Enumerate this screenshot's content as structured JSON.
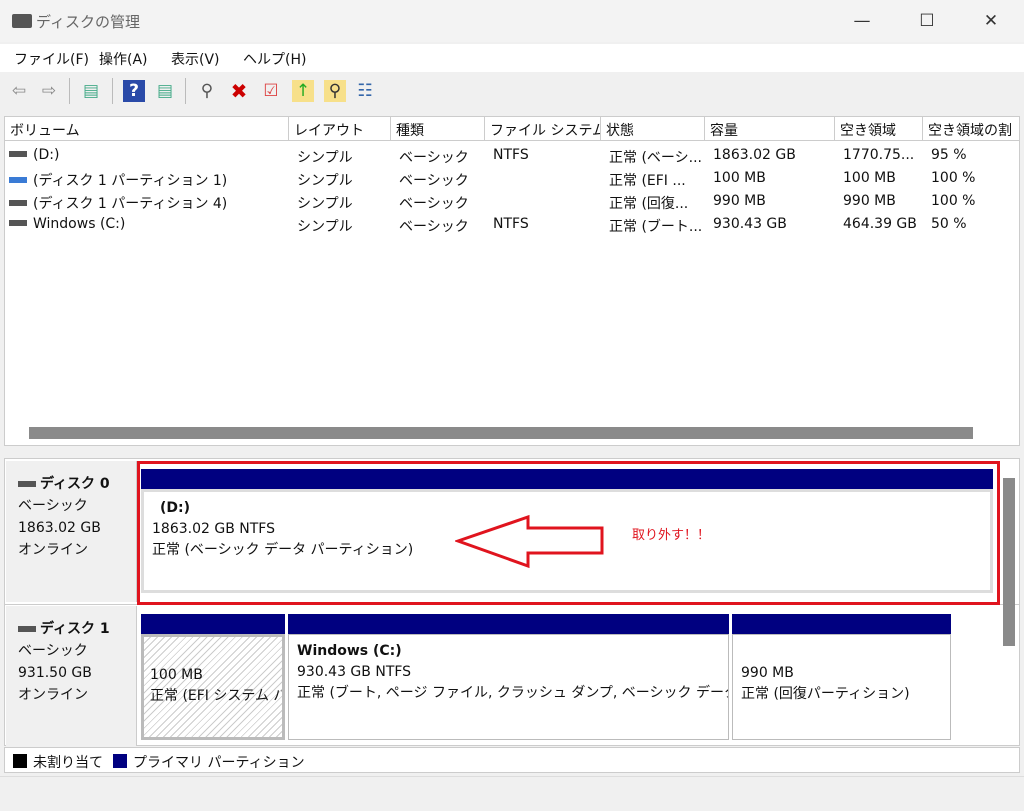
{
  "window": {
    "title": "ディスクの管理",
    "minimize": "—",
    "maximize": "☐",
    "close": "✕"
  },
  "menu": [
    "ファイル(F)",
    "操作(A)",
    "表示(V)",
    "ヘルプ(H)"
  ],
  "toolbar": [
    "back-icon",
    "forward-icon",
    "show-hide-console-tree-icon",
    "help-icon",
    "show-action-pane-icon",
    "connect-disk-icon",
    "delete-icon",
    "properties-icon",
    "export-icon",
    "find-icon",
    "settings-icon"
  ],
  "columns": [
    "ボリューム",
    "レイアウト",
    "種類",
    "ファイル システム",
    "状態",
    "容量",
    "空き領域",
    "空き領域の割"
  ],
  "rows": [
    [
      "(D:)",
      "シンプル",
      "ベーシック",
      "NTFS",
      "正常 (ベーシ...",
      "1863.02 GB",
      "1770.75...",
      "95 %"
    ],
    [
      "(ディスク 1 パーティション 1)",
      "シンプル",
      "ベーシック",
      "",
      "正常 (EFI ...",
      "100 MB",
      "100 MB",
      "100 %"
    ],
    [
      "(ディスク 1 パーティション 4)",
      "シンプル",
      "ベーシック",
      "",
      "正常 (回復...",
      "990 MB",
      "990 MB",
      "100 %"
    ],
    [
      "Windows (C:)",
      "シンプル",
      "ベーシック",
      "NTFS",
      "正常 (ブート...",
      "930.43 GB",
      "464.39 GB",
      "50 %"
    ]
  ],
  "disks": [
    {
      "name": "ディスク 0",
      "type": "ベーシック",
      "size": "1863.02 GB",
      "status": "オンライン",
      "partitions": [
        {
          "name": "(D:)",
          "size": "1863.02 GB NTFS",
          "status": "正常 (ベーシック データ パーティション)"
        }
      ]
    },
    {
      "name": "ディスク 1",
      "type": "ベーシック",
      "size": "931.50 GB",
      "status": "オンライン",
      "partitions": [
        {
          "name": "",
          "size": "100 MB",
          "status": "正常 (EFI システム パ"
        },
        {
          "name": "Windows  (C:)",
          "size": "930.43 GB NTFS",
          "status": "正常 (ブート, ページ ファイル, クラッシュ ダンプ, ベーシック データ パーティ"
        },
        {
          "name": "",
          "size": "990 MB",
          "status": "正常 (回復パーティション)"
        }
      ]
    }
  ],
  "annotation": "取り外す！！",
  "legend": [
    "未割り当て",
    "プライマリ パーティション"
  ],
  "colors": {
    "primary": "#000080",
    "unallocated": "#000000",
    "annotation": "#e0141e"
  }
}
